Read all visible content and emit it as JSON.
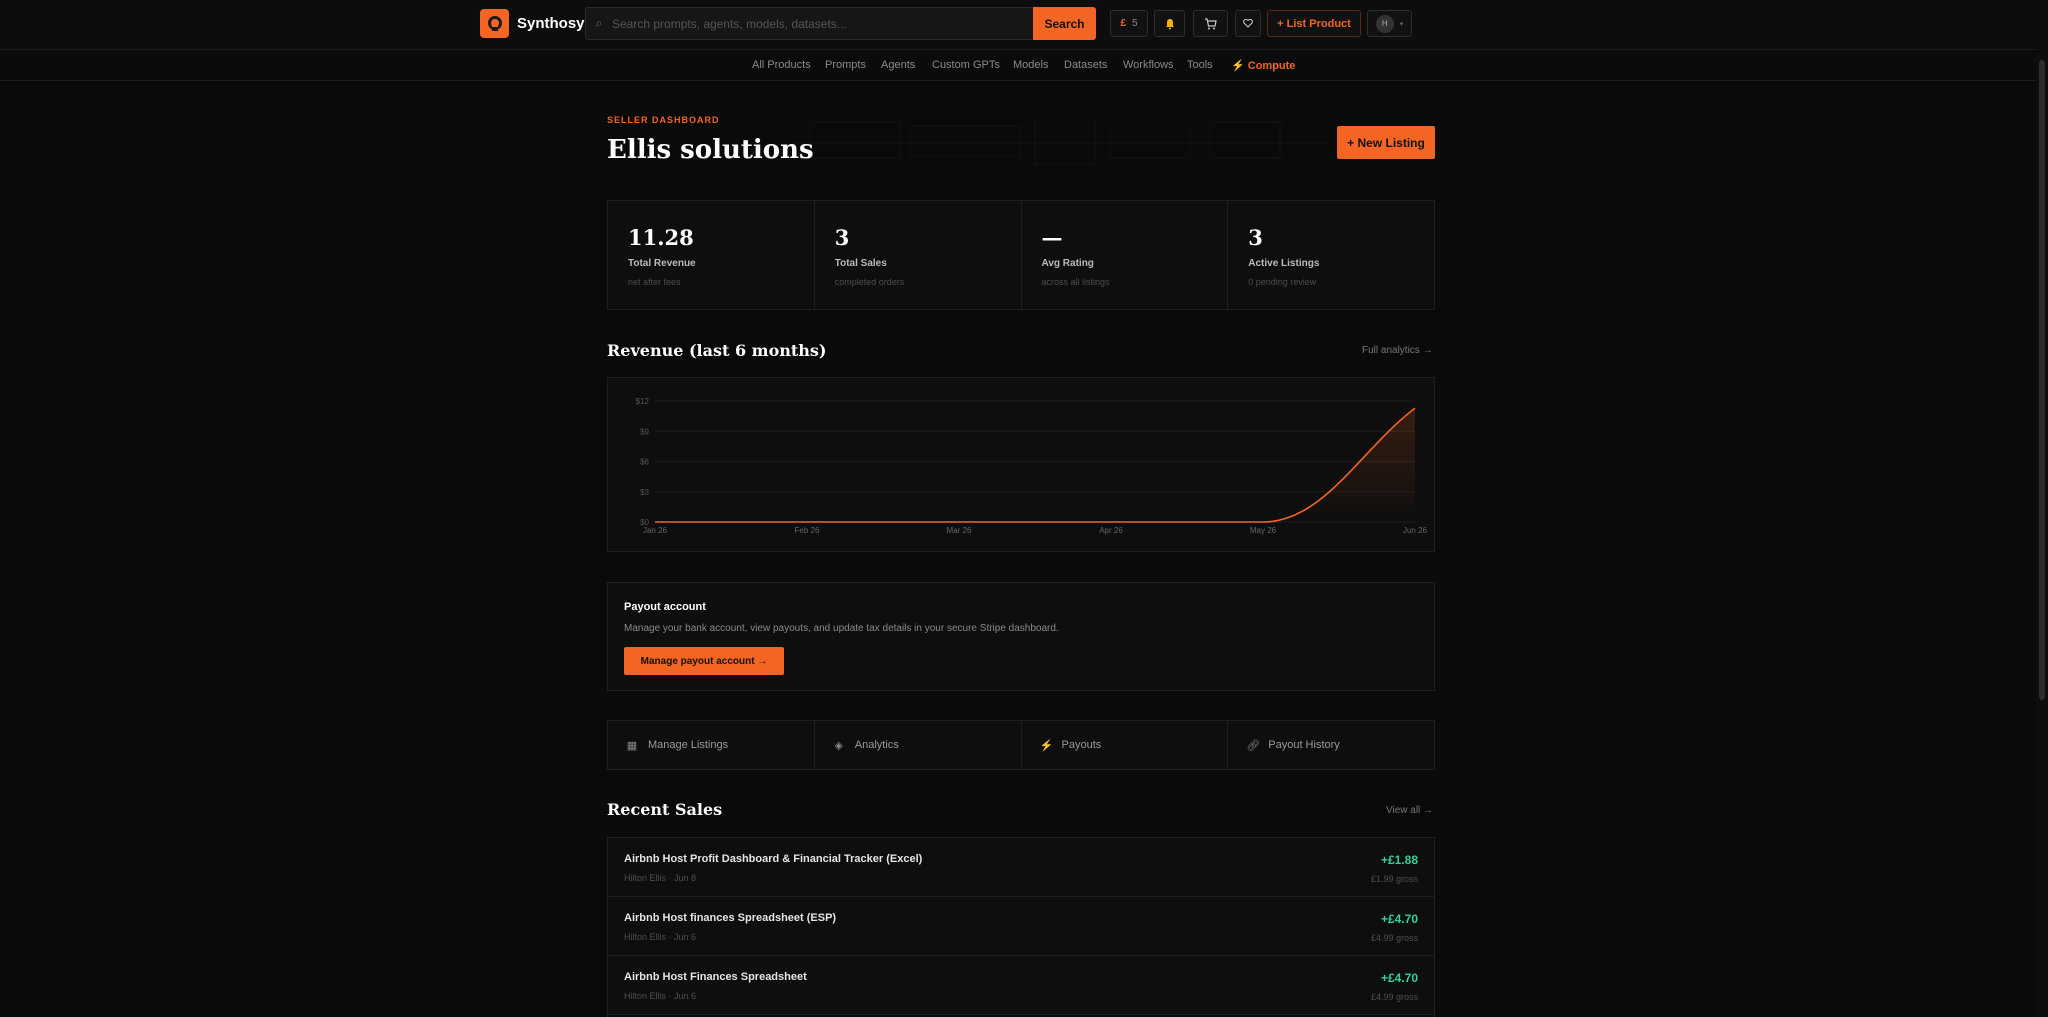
{
  "header": {
    "brand": "Synthosy",
    "search_placeholder": "Search prompts, agents, models, datasets...",
    "search_button": "Search",
    "currency_symbol": "£",
    "currency_count": "5",
    "list_product": "+ List Product",
    "avatar_initial": "H"
  },
  "nav": {
    "items": [
      "All Products",
      "Prompts",
      "Agents",
      "Custom GPTs",
      "Models",
      "Datasets",
      "Workflows",
      "Tools"
    ],
    "compute": "Compute"
  },
  "dashboard": {
    "eyebrow": "SELLER DASHBOARD",
    "title": "Ellis solutions",
    "new_listing": "+ New Listing"
  },
  "stats": [
    {
      "value": "11.28",
      "label": "Total Revenue",
      "sub": "net after fees"
    },
    {
      "value": "3",
      "label": "Total Sales",
      "sub": "completed orders"
    },
    {
      "value": "—",
      "label": "Avg Rating",
      "sub": "across all listings"
    },
    {
      "value": "3",
      "label": "Active Listings",
      "sub": "0 pending review"
    }
  ],
  "revenue": {
    "title": "Revenue (last 6 months)",
    "link": "Full analytics →"
  },
  "chart_data": {
    "type": "area",
    "categories": [
      "Jan 26",
      "Feb 26",
      "Mar 26",
      "Apr 26",
      "May 26",
      "Jun 26"
    ],
    "values": [
      0,
      0,
      0,
      0,
      0,
      11.28
    ],
    "y_ticks": [
      "$0",
      "$3",
      "$6",
      "$9",
      "$12"
    ],
    "ylim": [
      0,
      12
    ],
    "color": "#f26522",
    "grid": true
  },
  "payout": {
    "title": "Payout account",
    "description": "Manage your bank account, view payouts, and update tax details in your secure Stripe dashboard.",
    "button": "Manage payout account →"
  },
  "quick_actions": [
    {
      "label": "Manage Listings",
      "icon": "grid-icon"
    },
    {
      "label": "Analytics",
      "icon": "analytics-icon"
    },
    {
      "label": "Payouts",
      "icon": "lightning-icon"
    },
    {
      "label": "Payout History",
      "icon": "link-icon"
    }
  ],
  "recent_sales": {
    "title": "Recent Sales",
    "link": "View all →",
    "items": [
      {
        "name": "Airbnb Host Profit Dashboard & Financial Tracker (Excel)",
        "meta": "Hilton Ellis · Jun 8",
        "amount": "+£1.88",
        "gross": "£1.99 gross"
      },
      {
        "name": "Airbnb Host finances Spreadsheet (ESP)",
        "meta": "Hilton Ellis · Jun 6",
        "amount": "+£4.70",
        "gross": "£4.99 gross"
      },
      {
        "name": "Airbnb Host Finances Spreadsheet",
        "meta": "Hilton Ellis · Jun 6",
        "amount": "+£4.70",
        "gross": "£4.99 gross"
      }
    ]
  },
  "colors": {
    "accent": "#f26522",
    "positive": "#34d399",
    "background": "#0a0a0a"
  }
}
